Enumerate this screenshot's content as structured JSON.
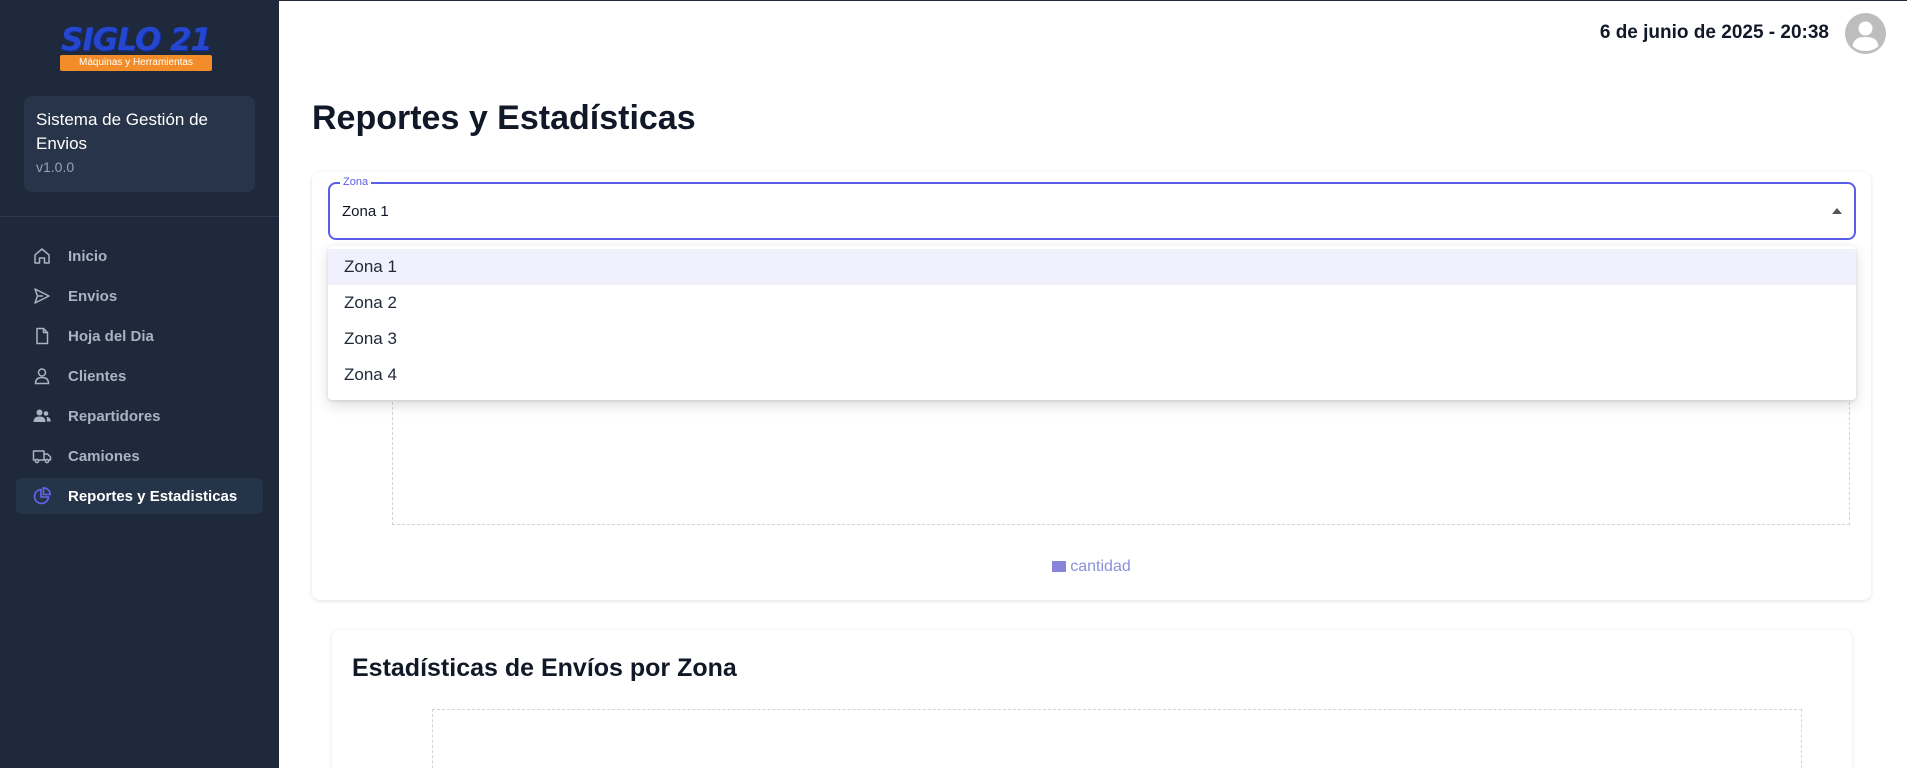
{
  "sidebar": {
    "logo": {
      "text": "SIGLO 21",
      "subtitle": "Máquinas y Herramientas"
    },
    "system": {
      "title": "Sistema de Gestión de Envios",
      "version": "v1.0.0"
    },
    "items": [
      {
        "label": "Inicio",
        "icon": "home-icon",
        "active": false
      },
      {
        "label": "Envios",
        "icon": "send-icon",
        "active": false
      },
      {
        "label": "Hoja del Dia",
        "icon": "document-icon",
        "active": false
      },
      {
        "label": "Clientes",
        "icon": "user-icon",
        "active": false
      },
      {
        "label": "Repartidores",
        "icon": "users-icon",
        "active": false
      },
      {
        "label": "Camiones",
        "icon": "truck-icon",
        "active": false
      },
      {
        "label": "Reportes y Estadisticas",
        "icon": "pie-chart-icon",
        "active": true
      }
    ]
  },
  "header": {
    "datetime": "6 de junio de 2025 - 20:38",
    "avatar_icon": "user-avatar-icon"
  },
  "main": {
    "title": "Reportes y Estadísticas",
    "zone_select": {
      "label": "Zona",
      "value": "Zona 1",
      "options": [
        "Zona 1",
        "Zona 2",
        "Zona 3",
        "Zona 4"
      ],
      "selected_index": 0
    },
    "chart": {
      "legend": "cantidad",
      "legend_color": "#8884d8"
    },
    "zone_stats": {
      "title": "Estadísticas de Envíos por Zona"
    }
  },
  "colors": {
    "sidebar_bg": "#1e293b",
    "accent": "#5b5fe8",
    "logo_blue": "#2547d0",
    "logo_orange": "#f28c28"
  }
}
